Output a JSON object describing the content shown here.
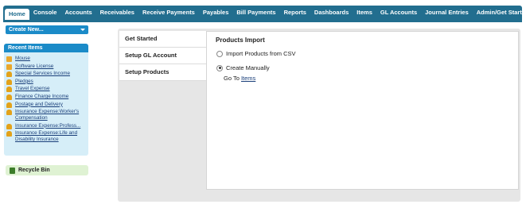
{
  "topnav": {
    "tabs": [
      {
        "label": "Home",
        "active": true
      },
      {
        "label": "Console"
      },
      {
        "label": "Accounts"
      },
      {
        "label": "Receivables"
      },
      {
        "label": "Receive Payments"
      },
      {
        "label": "Payables"
      },
      {
        "label": "Bill Payments"
      },
      {
        "label": "Reports"
      },
      {
        "label": "Dashboards"
      },
      {
        "label": "Items"
      },
      {
        "label": "GL Accounts"
      },
      {
        "label": "Journal Entries"
      },
      {
        "label": "Admin/Get Started"
      },
      {
        "label": "+"
      }
    ],
    "colors": {
      "bar": "#226e8f",
      "active_text": "#226e8f"
    }
  },
  "sidebar": {
    "create_new_label": "Create New...",
    "recent_items_title": "Recent Items",
    "recent_items": [
      {
        "label": "Mouse",
        "icon": "folder-icon"
      },
      {
        "label": "Software License",
        "icon": "folder-icon"
      },
      {
        "label": "Special Services Income",
        "icon": "bell-icon"
      },
      {
        "label": "Pledges",
        "icon": "bell-icon"
      },
      {
        "label": "Travel Expense",
        "icon": "bell-icon"
      },
      {
        "label": "Finance Charge Income",
        "icon": "bell-icon"
      },
      {
        "label": "Postage and Delivery",
        "icon": "bell-icon"
      },
      {
        "label": "Insurance Expense:Worker's Compensation",
        "icon": "bell-icon"
      },
      {
        "label": "Insurance Expense:Profess...",
        "icon": "bell-icon"
      },
      {
        "label": "Insurance Expense:Life and Disability Insurance",
        "icon": "bell-icon"
      }
    ],
    "recycle_bin_label": "Recycle Bin"
  },
  "setup": {
    "steps": [
      {
        "label": "Get Started"
      },
      {
        "label": "Setup GL Account"
      },
      {
        "label": "Setup Products",
        "selected": true
      }
    ],
    "content": {
      "title": "Products Import",
      "options": [
        {
          "label": "Import Products from CSV",
          "checked": false
        },
        {
          "label": "Create Manually",
          "checked": true
        }
      ],
      "goto_prefix": "Go To",
      "goto_link": "Items"
    }
  }
}
